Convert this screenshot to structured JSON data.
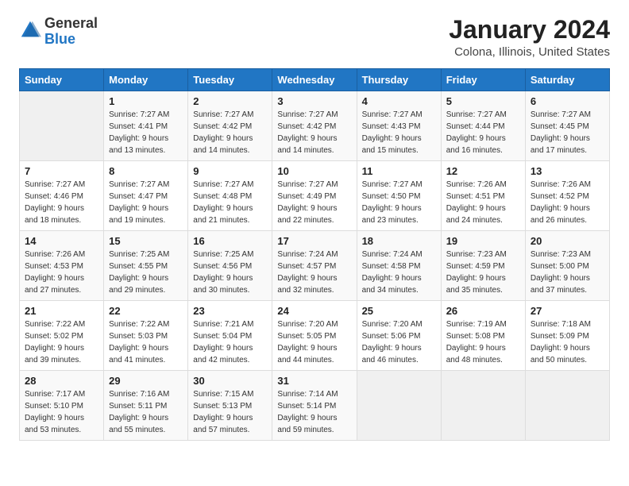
{
  "header": {
    "logo_general": "General",
    "logo_blue": "Blue",
    "month_title": "January 2024",
    "location": "Colona, Illinois, United States"
  },
  "days_of_week": [
    "Sunday",
    "Monday",
    "Tuesday",
    "Wednesday",
    "Thursday",
    "Friday",
    "Saturday"
  ],
  "weeks": [
    [
      {
        "day": null
      },
      {
        "day": "1",
        "sunrise": "7:27 AM",
        "sunset": "4:41 PM",
        "daylight": "9 hours and 13 minutes."
      },
      {
        "day": "2",
        "sunrise": "7:27 AM",
        "sunset": "4:42 PM",
        "daylight": "9 hours and 14 minutes."
      },
      {
        "day": "3",
        "sunrise": "7:27 AM",
        "sunset": "4:42 PM",
        "daylight": "9 hours and 14 minutes."
      },
      {
        "day": "4",
        "sunrise": "7:27 AM",
        "sunset": "4:43 PM",
        "daylight": "9 hours and 15 minutes."
      },
      {
        "day": "5",
        "sunrise": "7:27 AM",
        "sunset": "4:44 PM",
        "daylight": "9 hours and 16 minutes."
      },
      {
        "day": "6",
        "sunrise": "7:27 AM",
        "sunset": "4:45 PM",
        "daylight": "9 hours and 17 minutes."
      }
    ],
    [
      {
        "day": "7",
        "sunrise": "7:27 AM",
        "sunset": "4:46 PM",
        "daylight": "9 hours and 18 minutes."
      },
      {
        "day": "8",
        "sunrise": "7:27 AM",
        "sunset": "4:47 PM",
        "daylight": "9 hours and 19 minutes."
      },
      {
        "day": "9",
        "sunrise": "7:27 AM",
        "sunset": "4:48 PM",
        "daylight": "9 hours and 21 minutes."
      },
      {
        "day": "10",
        "sunrise": "7:27 AM",
        "sunset": "4:49 PM",
        "daylight": "9 hours and 22 minutes."
      },
      {
        "day": "11",
        "sunrise": "7:27 AM",
        "sunset": "4:50 PM",
        "daylight": "9 hours and 23 minutes."
      },
      {
        "day": "12",
        "sunrise": "7:26 AM",
        "sunset": "4:51 PM",
        "daylight": "9 hours and 24 minutes."
      },
      {
        "day": "13",
        "sunrise": "7:26 AM",
        "sunset": "4:52 PM",
        "daylight": "9 hours and 26 minutes."
      }
    ],
    [
      {
        "day": "14",
        "sunrise": "7:26 AM",
        "sunset": "4:53 PM",
        "daylight": "9 hours and 27 minutes."
      },
      {
        "day": "15",
        "sunrise": "7:25 AM",
        "sunset": "4:55 PM",
        "daylight": "9 hours and 29 minutes."
      },
      {
        "day": "16",
        "sunrise": "7:25 AM",
        "sunset": "4:56 PM",
        "daylight": "9 hours and 30 minutes."
      },
      {
        "day": "17",
        "sunrise": "7:24 AM",
        "sunset": "4:57 PM",
        "daylight": "9 hours and 32 minutes."
      },
      {
        "day": "18",
        "sunrise": "7:24 AM",
        "sunset": "4:58 PM",
        "daylight": "9 hours and 34 minutes."
      },
      {
        "day": "19",
        "sunrise": "7:23 AM",
        "sunset": "4:59 PM",
        "daylight": "9 hours and 35 minutes."
      },
      {
        "day": "20",
        "sunrise": "7:23 AM",
        "sunset": "5:00 PM",
        "daylight": "9 hours and 37 minutes."
      }
    ],
    [
      {
        "day": "21",
        "sunrise": "7:22 AM",
        "sunset": "5:02 PM",
        "daylight": "9 hours and 39 minutes."
      },
      {
        "day": "22",
        "sunrise": "7:22 AM",
        "sunset": "5:03 PM",
        "daylight": "9 hours and 41 minutes."
      },
      {
        "day": "23",
        "sunrise": "7:21 AM",
        "sunset": "5:04 PM",
        "daylight": "9 hours and 42 minutes."
      },
      {
        "day": "24",
        "sunrise": "7:20 AM",
        "sunset": "5:05 PM",
        "daylight": "9 hours and 44 minutes."
      },
      {
        "day": "25",
        "sunrise": "7:20 AM",
        "sunset": "5:06 PM",
        "daylight": "9 hours and 46 minutes."
      },
      {
        "day": "26",
        "sunrise": "7:19 AM",
        "sunset": "5:08 PM",
        "daylight": "9 hours and 48 minutes."
      },
      {
        "day": "27",
        "sunrise": "7:18 AM",
        "sunset": "5:09 PM",
        "daylight": "9 hours and 50 minutes."
      }
    ],
    [
      {
        "day": "28",
        "sunrise": "7:17 AM",
        "sunset": "5:10 PM",
        "daylight": "9 hours and 53 minutes."
      },
      {
        "day": "29",
        "sunrise": "7:16 AM",
        "sunset": "5:11 PM",
        "daylight": "9 hours and 55 minutes."
      },
      {
        "day": "30",
        "sunrise": "7:15 AM",
        "sunset": "5:13 PM",
        "daylight": "9 hours and 57 minutes."
      },
      {
        "day": "31",
        "sunrise": "7:14 AM",
        "sunset": "5:14 PM",
        "daylight": "9 hours and 59 minutes."
      },
      {
        "day": null
      },
      {
        "day": null
      },
      {
        "day": null
      }
    ]
  ],
  "labels": {
    "sunrise": "Sunrise:",
    "sunset": "Sunset:",
    "daylight": "Daylight:"
  }
}
